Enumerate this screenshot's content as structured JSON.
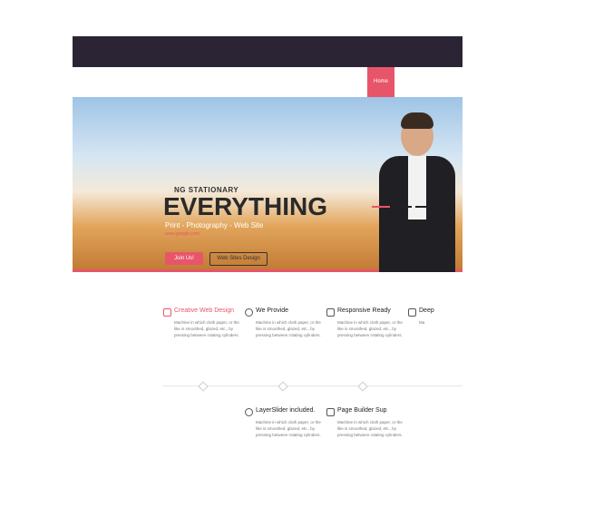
{
  "nav": {
    "home_label": "Home"
  },
  "hero": {
    "kicker": "NG STATIONARY",
    "headline": "EVERYTHING",
    "subline": "Print - Photography - Web Site",
    "url": "www.google.com",
    "join_label": "Join Us!",
    "web_label": "Web Sites Design"
  },
  "features": [
    {
      "title": "Creative Web Design",
      "desc": "Machine in which cloth paper, or the like is smoothed, glazed, etc., by pressing between rotating cylinders.",
      "icon": "checkbox-icon"
    },
    {
      "title": "We Provide",
      "desc": "Machine in which cloth paper, or the like is smoothed, glazed, etc., by pressing between rotating cylinders.",
      "icon": "lightbulb-icon"
    },
    {
      "title": "Responsive Ready",
      "desc": "Machine in which cloth paper, or the like is smoothed, glazed, etc., by pressing between rotating cylinders.",
      "icon": "chat-icon"
    },
    {
      "title": "Deep",
      "desc": "Ma",
      "icon": "briefcase-icon"
    },
    {
      "title": "LayerSlider included.",
      "desc": "Machine in which cloth paper, or the like is smoothed, glazed, etc., by pressing between rotating cylinders.",
      "icon": "clock-icon"
    },
    {
      "title": "Page Builder Sup",
      "desc": "Machine in which cloth paper, or the like is smoothed, glazed, etc., by pressing between rotating cylinders.",
      "icon": "image-icon"
    }
  ],
  "colors": {
    "accent": "#e8556a",
    "dark": "#2b2434"
  }
}
